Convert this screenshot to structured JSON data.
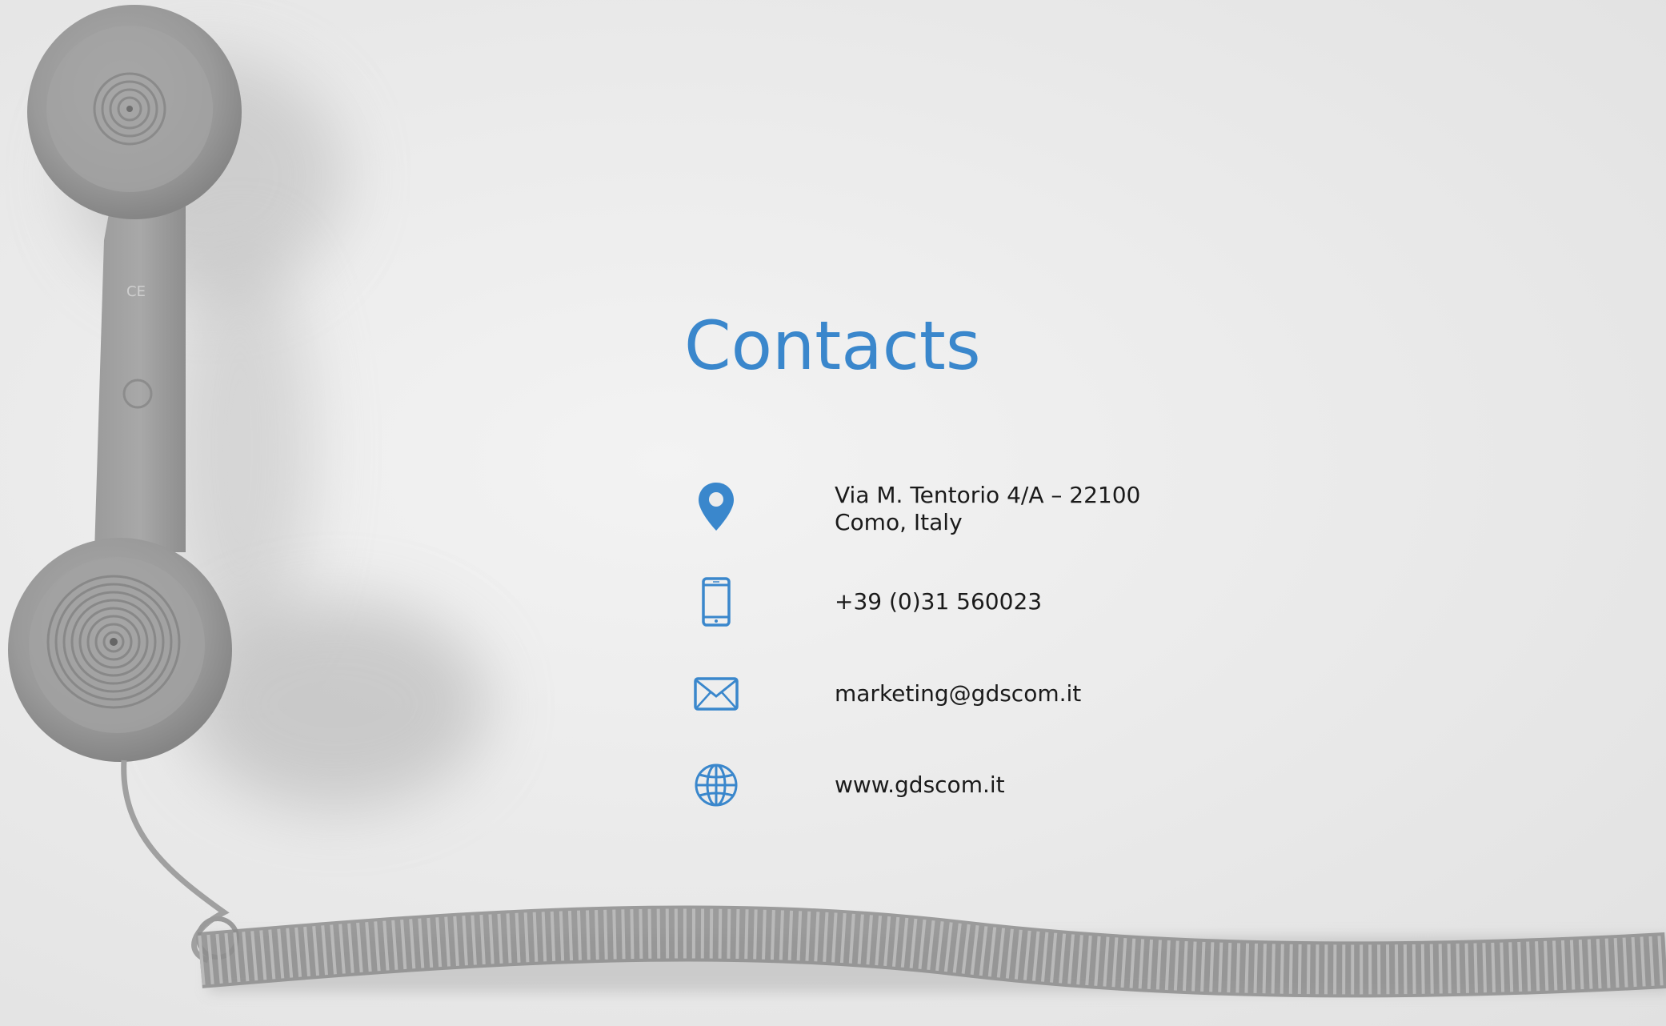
{
  "slide": {
    "title": "Contacts",
    "accent_color": "#3a87cc",
    "text_color": "#1a1a1a",
    "background_image": "grey retro telephone handset with coiled cord on light grey background"
  },
  "contacts": {
    "address": {
      "icon": "location-pin-icon",
      "line1": "Via M. Tentorio 4/A – 22100",
      "line2": "Como, Italy"
    },
    "phone": {
      "icon": "smartphone-icon",
      "text": "+39 (0)31 560023"
    },
    "email": {
      "icon": "envelope-icon",
      "text": "marketing@gdscom.it"
    },
    "website": {
      "icon": "globe-icon",
      "text": "www.gdscom.it"
    }
  }
}
